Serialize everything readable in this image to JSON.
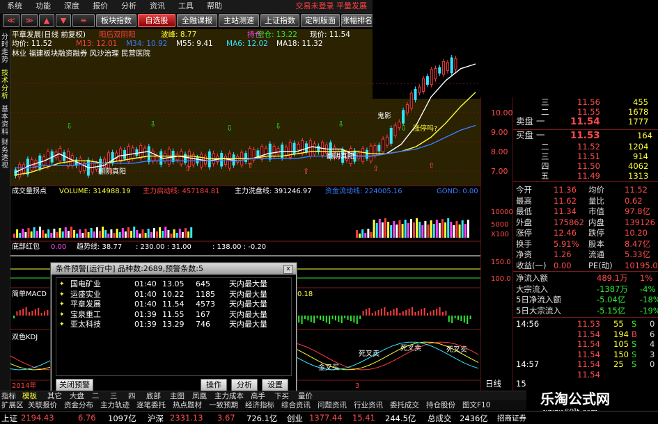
{
  "menu": {
    "items": [
      "系统",
      "功能",
      "深度",
      "报价",
      "分析",
      "资讯",
      "工具",
      "帮助"
    ],
    "right_text": "交易未登录  平量发展"
  },
  "toolbar": {
    "buttons": [
      "板块指数",
      "自选股",
      "全融课报",
      "主站测速",
      "上证指数",
      "定制版面",
      "涨幅排名"
    ]
  },
  "left_tabs": [
    "分时走势",
    "技术分析",
    "基本资料",
    "财务透视"
  ],
  "chart": {
    "stock_title": "平章发展(日线 前复权)",
    "pattern_label": "阳后双阴阳",
    "volatility_label": "波峰: 8.77",
    "hold_label": "持仓: ",
    "empty_label": "空仓: 13.22",
    "current_label": "现价: 11.54",
    "avg_label": "均价: 11.52",
    "m13": "M13: 12.01",
    "m34": "M34: 10.92",
    "m55": "M55: 9.41",
    "ma6": "MA6: 12.02",
    "ma18": "MA18: 11.32",
    "concepts": "林业  福建板块融资融券  风沙治理  民营医院",
    "annotations": {
      "a1": "鬼影",
      "a2": "翻阴真阳",
      "a3": "翻阴真阳",
      "a4": "涨停吗?"
    },
    "volume_panel": {
      "title": "成交量拐点",
      "volume": "VOLUME: 314988.19",
      "main_start": "主力启动线: 457184.81",
      "wash": "主力洗盘线: 391246.97",
      "ext1": "资金流动线: 224005.16",
      "ext2": "GOND: 0.00"
    },
    "bottom_red_panel": {
      "title": "底部红包",
      "v1": "0.00",
      "trend": "趋势线: 38.77",
      "v2": ": 230.00 : 31.00",
      "v3": ": 138.00 : -0.20"
    },
    "macd_panel": {
      "title": "简单MACD",
      "v1": "0.18"
    },
    "kdj_panel": {
      "title": "双色KDJ",
      "t1": "死叉卖",
      "t2": "死叉卖",
      "t3": "死叉卖",
      "t4": "金叉买"
    },
    "x_year": "2014年",
    "x_month": "3",
    "chart_data": {
      "type": "line",
      "title": "平章发展(日线 前复权)",
      "ylim": [
        7,
        12
      ],
      "yticks": [
        7,
        8,
        9,
        10,
        11
      ],
      "series": [
        {
          "name": "MA6",
          "values": [
            7.4,
            7.7,
            7.9,
            8.2,
            7.9,
            7.6,
            7.7,
            8.1,
            8.2,
            8.3,
            8.0,
            8.1,
            8.0,
            7.9,
            8.0,
            7.9,
            8.0,
            8.2,
            8.3,
            8.3,
            8.5,
            8.4,
            8.4,
            8.1,
            8.1,
            8.2,
            8.6,
            9.4,
            10.6,
            11.3,
            11.8,
            12.0
          ]
        },
        {
          "name": "MA18",
          "values": [
            7.3,
            7.4,
            7.6,
            7.8,
            7.9,
            7.9,
            7.8,
            7.9,
            8.0,
            8.1,
            8.1,
            8.1,
            8.1,
            8.0,
            8.0,
            8.0,
            8.0,
            8.1,
            8.1,
            8.2,
            8.3,
            8.3,
            8.3,
            8.3,
            8.2,
            8.2,
            8.3,
            8.5,
            8.9,
            9.5,
            10.2,
            10.8
          ]
        },
        {
          "name": "M55",
          "values": [
            7.6,
            7.6,
            7.7,
            7.7,
            7.7,
            7.8,
            7.8,
            7.8,
            7.8,
            7.9,
            7.9,
            7.9,
            7.9,
            7.9,
            7.9,
            7.9,
            8.0,
            8.0,
            8.0,
            8.0,
            8.1,
            8.1,
            8.1,
            8.1,
            8.1,
            8.2,
            8.3,
            8.4,
            8.6,
            8.9,
            9.2,
            9.4
          ]
        }
      ]
    }
  },
  "y_axis": {
    "labels": [
      "10.00",
      "9.00",
      "8.00",
      "7.00"
    ],
    "vol_labels": [
      "10000",
      "5000",
      "X100",
      "150.0",
      "100.0"
    ]
  },
  "popup": {
    "title": "条件预警[运行中] 品种数:2689,预警条数:5",
    "close": "x",
    "rows": [
      {
        "name": "国电矿业",
        "time": "01:40",
        "price": "13.05",
        "vol": "645",
        "cond": "天内最大量"
      },
      {
        "name": "运盛实业",
        "time": "01:40",
        "price": "10.22",
        "vol": "1185",
        "cond": "天内最大量"
      },
      {
        "name": "平章发展",
        "time": "01:40",
        "price": "11.54",
        "vol": "4573",
        "cond": "天内最大量"
      },
      {
        "name": "宝泉重工",
        "time": "01:39",
        "price": "11.55",
        "vol": "167",
        "cond": "天内最大量"
      },
      {
        "name": "亚太科技",
        "time": "01:39",
        "price": "13.29",
        "vol": "746",
        "cond": "天内最大量"
      }
    ],
    "buttons": {
      "close_alert": "关闭预警",
      "operate": "操作",
      "analyze": "分析",
      "settings": "设置"
    }
  },
  "quote": {
    "asks": [
      {
        "label": "三",
        "price": "11.56",
        "vol": "455"
      },
      {
        "label": "二",
        "price": "11.55",
        "vol": "1678"
      },
      {
        "label": "卖盘  一",
        "price": "11.54",
        "vol": "1777"
      }
    ],
    "bids": [
      {
        "label": "买盘  一",
        "price": "11.53",
        "vol": "164"
      },
      {
        "label": "二",
        "price": "11.52",
        "vol": "1204"
      },
      {
        "label": "三",
        "price": "11.51",
        "vol": "914"
      },
      {
        "label": "四",
        "price": "11.50",
        "vol": "4062"
      },
      {
        "label": "五",
        "price": "11.49",
        "vol": "1313"
      }
    ],
    "stats": [
      {
        "k1": "今开",
        "v1": "11.36",
        "k2": "均价",
        "v2": "11.52"
      },
      {
        "k1": "最高",
        "v1": "11.62",
        "k2": "量比",
        "v2": "0.62"
      },
      {
        "k1": "最低",
        "v1": "11.34",
        "k2": "市值",
        "v2": "97.8亿"
      },
      {
        "k1": "外盘",
        "v1": "175862",
        "k2": "内盘",
        "v2": "139126"
      },
      {
        "k1": "涨停",
        "v1": "12.46",
        "k2": "跌停",
        "v2": "10.20"
      },
      {
        "k1": "换手",
        "v1": "5.91%",
        "k2": "股本",
        "v2": "8.47亿"
      },
      {
        "k1": "净资",
        "v1": "1.26",
        "k2": "流通",
        "v2": "5.33亿"
      },
      {
        "k1": "收益(一)",
        "v1": "0.00",
        "k2": "PE(动)",
        "v2": "10195.0"
      }
    ],
    "flows": [
      {
        "label": "净流入额",
        "value": "489.1万",
        "pct": "1%"
      },
      {
        "label": "大宗流入",
        "value": "-1387万",
        "pct": "-4%"
      },
      {
        "label": "5日净流入额",
        "value": "-5.04亿",
        "pct": "-18%"
      },
      {
        "label": "5日大宗流入",
        "value": "-5.15亿",
        "pct": "-19%"
      }
    ],
    "ticks": [
      {
        "time": "14:56",
        "price": "11.53",
        "vol": "55",
        "side": "S",
        "count": "0"
      },
      {
        "time": "",
        "price": "11.54",
        "vol": "194",
        "side": "B",
        "count": "6"
      },
      {
        "time": "",
        "price": "11.54",
        "vol": "105",
        "side": "S",
        "count": "4"
      },
      {
        "time": "",
        "price": "11.54",
        "vol": "150",
        "side": "S",
        "count": "3"
      },
      {
        "time": "14:57",
        "price": "11.54",
        "vol": "25",
        "side": "S",
        "count": "0"
      },
      {
        "time": "",
        "price": "11.54",
        "vol": "",
        "side": "",
        "count": ""
      }
    ],
    "period_label": "日线",
    "period_num": "15"
  },
  "bottom_tabs_row1": [
    "指标",
    "模板",
    "其它",
    "大盘",
    "二",
    "三",
    "四",
    "底部",
    "主图",
    "凤凰",
    "主力成本",
    "高手",
    "下买",
    "量价"
  ],
  "bottom_tabs_row2": [
    "扩展区",
    "关联报价",
    "资金分布",
    "主力轨迹",
    "逐笔委托",
    "热点题材",
    "一致预期",
    "经济指标",
    "综合资讯",
    "问题资讯",
    "行业资讯",
    "委托成交",
    "持仓股份",
    "图文F10"
  ],
  "statusbar": {
    "sh_label": "上证",
    "sh_val": "2194.43",
    "sh_chg": "6.76",
    "sh_amt": "1097亿",
    "hs_label": "沪深",
    "hs_val": "2331.13",
    "hs_chg": "3.67",
    "hs_amt": "726.1亿",
    "cy_label": "创业",
    "cy_val": "1377.44",
    "cy_chg": "15.41",
    "cy_amt": "244.5亿",
    "total_label": "总成交",
    "total_val": "2436亿",
    "broker": "招商证券"
  },
  "brand": {
    "name": "乐淘公式网",
    "url": "www.60lt.com"
  }
}
